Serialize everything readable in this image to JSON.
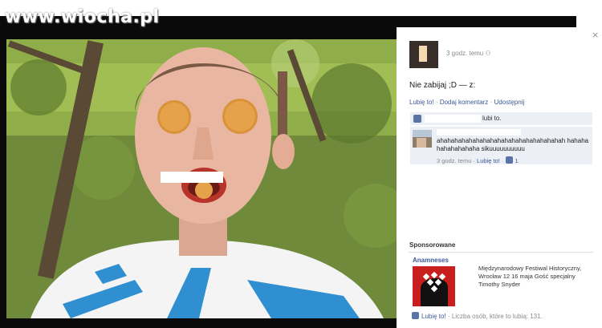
{
  "watermark": "www.wiocha.pl",
  "colors": {
    "facebook_blue": "#3b5998",
    "frame_dark": "#0a0a0a",
    "ad_red": "#c81e1e",
    "comment_bg": "#eceff5"
  },
  "sidebar": {
    "close_icon": "×",
    "post": {
      "time": "3 godz. temu",
      "privacy_icon": "friends-icon",
      "message": "Nie zabijaj ;D — z:",
      "actions": [
        "Lubię to!",
        "Dodaj komentarz",
        "Udostępnij"
      ],
      "likes_text": "lubi to."
    },
    "comment": {
      "text": "ahahahahahahahahahahahahahahahahahah hahahahahahahahaha sikuuuuuuuuuu",
      "time": "3 godz. temu",
      "like_label": "Lubię to!",
      "like_count": "1"
    },
    "sponsored": {
      "heading": "Sponsorowane",
      "ad_title": "Anamneses",
      "ad_text": "Międzynarodowy Festiwal Historyczny, Wrocław 12 16 maja Gość specjalny Timothy Snyder",
      "like_label": "Lubię to!",
      "like_count_text": "Liczba osób, które to lubią: 131."
    }
  }
}
